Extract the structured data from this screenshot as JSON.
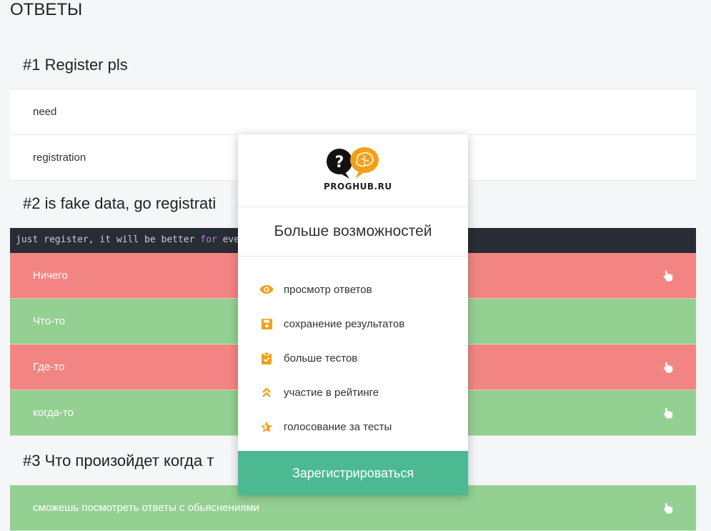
{
  "page": {
    "title": "ОТВЕТЫ"
  },
  "questions": [
    {
      "title": "#1 Register pls",
      "answers": [
        {
          "text": "need",
          "status": "neutral"
        },
        {
          "text": "registration",
          "status": "neutral"
        }
      ]
    },
    {
      "title": "#2 is fake data, go registrati",
      "code": {
        "prefix": "just register, it will be better ",
        "keyword": "for",
        "suffix": " eve"
      },
      "answers": [
        {
          "text": "Ничего",
          "status": "wrong",
          "icon": "hand-pointer-icon"
        },
        {
          "text": "Что-то",
          "status": "correct"
        },
        {
          "text": "Где-то",
          "status": "wrong",
          "icon": "hand-pointer-icon"
        },
        {
          "text": "когда-то",
          "status": "correct",
          "icon": "hand-pointer-icon"
        }
      ]
    },
    {
      "title": "#3 Что произойдет когда т",
      "answers": [
        {
          "text": "сможешь посмотреть ответы с обьяснениями",
          "status": "correct",
          "icon": "hand-pointer-icon"
        }
      ]
    }
  ],
  "modal": {
    "logo_text": "PROGHUB.RU",
    "title": "Больше возможностей",
    "features": [
      {
        "icon": "eye-icon",
        "label": "просмотр ответов"
      },
      {
        "icon": "floppy-disk-icon",
        "label": "сохранение результатов"
      },
      {
        "icon": "clipboard-check-icon",
        "label": "больше тестов"
      },
      {
        "icon": "double-chevron-up-icon",
        "label": "участие в рейтинге"
      },
      {
        "icon": "star-icon",
        "label": "голосование за тесты"
      }
    ],
    "button_label": "Зарегистрироваться"
  },
  "colors": {
    "wrong": "#f28583",
    "correct": "#93d092",
    "accent": "#f2a018",
    "button": "#4cb992",
    "code_bg": "#282c34"
  }
}
